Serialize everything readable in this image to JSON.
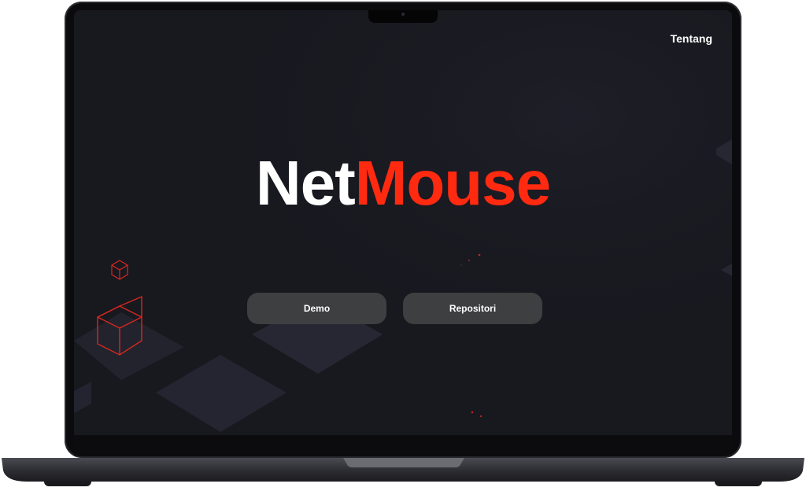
{
  "nav": {
    "about_label": "Tentang"
  },
  "hero": {
    "title_part1": "Net",
    "title_part2": "Mouse"
  },
  "actions": {
    "demo_label": "Demo",
    "repository_label": "Repositori"
  },
  "colors": {
    "background": "#18181f",
    "accent": "#ff2a10",
    "button": "#3d3f40",
    "text": "#ffffff"
  }
}
